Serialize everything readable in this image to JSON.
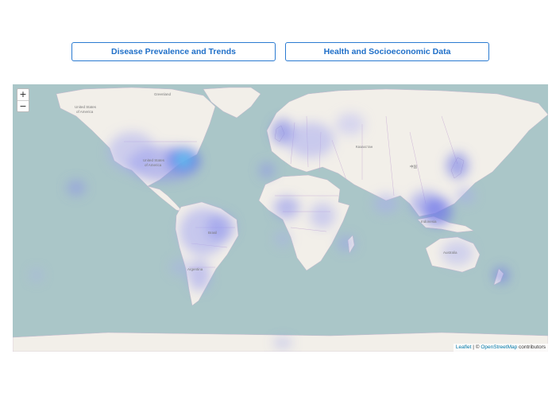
{
  "buttons": {
    "disease": "Disease Prevalence and Trends",
    "health": "Health and Socioeconomic Data"
  },
  "map": {
    "zoom_in": "+",
    "zoom_out": "−",
    "attribution": {
      "leaflet": "Leaflet",
      "separator": " | © ",
      "osm": "OpenStreetMap",
      "suffix": " contributors"
    },
    "labels": {
      "greenland": "Greenland",
      "usa_north_1": "United States",
      "usa_north_2": "of America",
      "usa_main_1": "United States",
      "usa_main_2": "of America",
      "kazakhstan": "Казахстан",
      "china": "中国",
      "brasil": "Brasil",
      "argentina": "Argentina",
      "australia": "Australia",
      "indonesia": "Indonesia"
    },
    "colors": {
      "water": "#aac6c8",
      "land": "#f2efe9",
      "heat_low": "#c4c4f2",
      "heat_mid": "#6f78e8",
      "heat_high": "#5fd0f0"
    }
  }
}
